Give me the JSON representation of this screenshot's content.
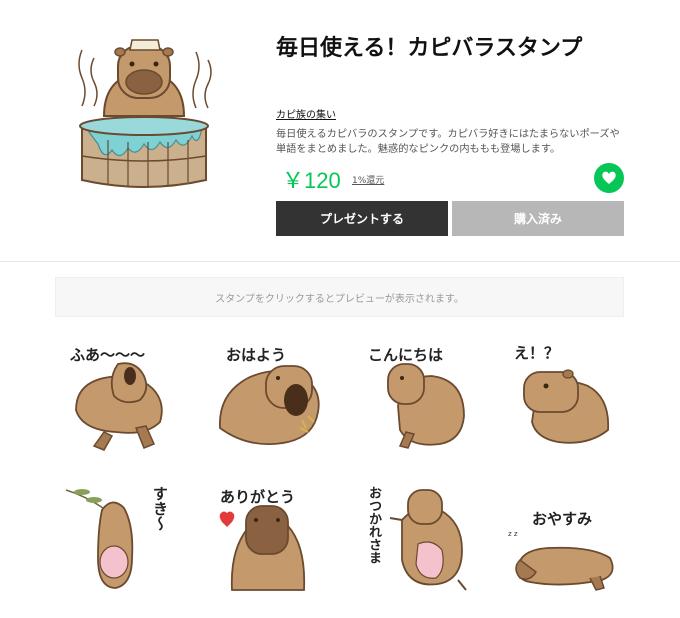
{
  "product": {
    "title": "毎日使える！カピバラスタンプ",
    "author": "カピ族の集い",
    "description": "毎日使えるカピバラのスタンプです。カピバラ好きにはたまらないポーズや単語をまとめました。魅惑的なピンクの内ももも登場します。",
    "price": "￥120",
    "return_label": "1%還元",
    "gift_button": "プレゼントする",
    "purchased_button": "購入済み",
    "accent_color": "#06c755"
  },
  "preview": {
    "hint": "スタンプをクリックするとプレビューが表示されます。"
  },
  "stamps": [
    {
      "text": "ふあ〜〜〜"
    },
    {
      "text": "おはよう"
    },
    {
      "text": "こんにちは"
    },
    {
      "text": "え！？"
    },
    {
      "text": "すき〜"
    },
    {
      "text": "ありがとう"
    },
    {
      "text": "おつかれさま"
    },
    {
      "text": "おやすみ"
    }
  ]
}
